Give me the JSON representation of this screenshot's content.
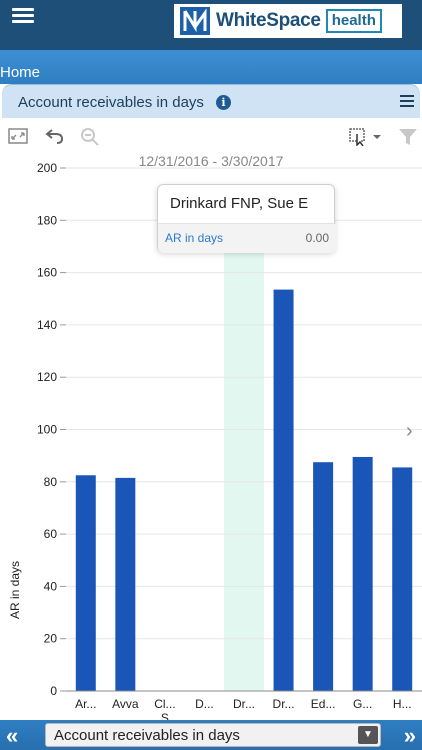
{
  "header": {
    "logo_word": "WhiteSpace",
    "logo_box": "health",
    "home_label": "Home",
    "panel_title": "Account receivables in days",
    "info_icon": "i"
  },
  "toolbar": {
    "date_range": "12/31/2016 - 3/30/2017"
  },
  "chart_data": {
    "type": "bar",
    "ylabel": "AR in days",
    "xlabel": "",
    "ylim": [
      0,
      200
    ],
    "yticks": [
      0,
      20,
      40,
      60,
      80,
      100,
      120,
      140,
      160,
      180,
      200
    ],
    "categories": [
      "Ar...",
      "Avva",
      "Cl... S",
      "D...",
      "Dr...",
      "Dr...",
      "Ed...",
      "G...",
      "H..."
    ],
    "values": [
      82.5,
      81.5,
      0,
      0,
      0,
      153.5,
      87.5,
      89.5,
      85.5
    ],
    "highlighted_index": 4,
    "bar_color": "#1a56b8",
    "highlight_color": "#e3f7f1",
    "grid": true
  },
  "tooltip": {
    "name": "Drinkard FNP, Sue E",
    "series_label": "AR in days",
    "value": "0.00"
  },
  "bottom_nav": {
    "prev": "«",
    "next": "»",
    "select_value": "Account receivables in days",
    "select_arrow": "▼"
  }
}
